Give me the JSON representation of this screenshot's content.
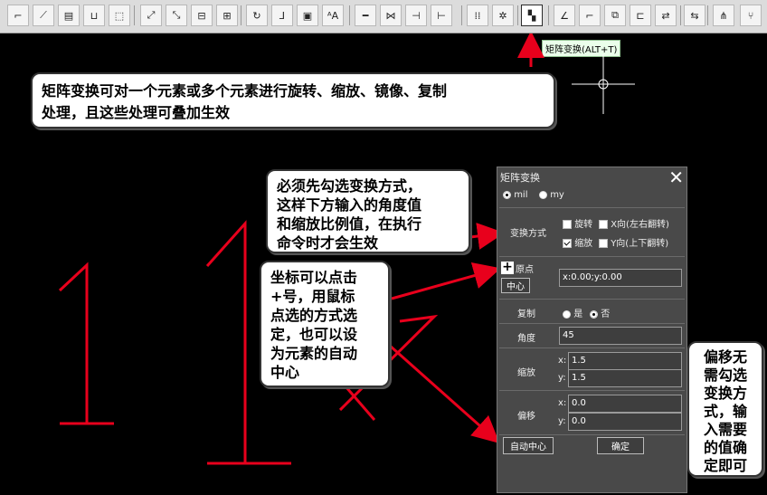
{
  "toolbar": {
    "buttons": [
      {
        "name": "connect-icon",
        "glyph": "⌐"
      },
      {
        "name": "route-icon",
        "glyph": "⟋"
      },
      {
        "name": "document-settings-icon",
        "glyph": "▤"
      },
      {
        "name": "tray-icon",
        "glyph": "⊔"
      },
      {
        "name": "select-box-icon",
        "glyph": "⬚"
      },
      {
        "name": "transform-icon",
        "glyph": "⤢"
      },
      {
        "name": "resize-icon",
        "glyph": "⤡"
      },
      {
        "name": "align-center-icon",
        "glyph": "⊟"
      },
      {
        "name": "align-middle-icon",
        "glyph": "⊞"
      },
      {
        "name": "rotate-icon",
        "glyph": "↻"
      },
      {
        "name": "flip-icon",
        "glyph": "⅃"
      },
      {
        "name": "layer-settings-icon",
        "glyph": "▣"
      },
      {
        "name": "text-size-icon",
        "glyph": "ᴬA"
      },
      {
        "name": "wire-break-icon",
        "glyph": "━"
      },
      {
        "name": "cross-wire-icon",
        "glyph": "⋈"
      },
      {
        "name": "line-left-icon",
        "glyph": "⊣"
      },
      {
        "name": "line-right-icon",
        "glyph": "⊢"
      },
      {
        "name": "grid-icon",
        "glyph": "⁞⁞"
      },
      {
        "name": "snowflake-icon",
        "glyph": "✲"
      },
      {
        "name": "matrix-transform-icon",
        "glyph": "▚"
      },
      {
        "name": "angle-icon",
        "glyph": "∠"
      },
      {
        "name": "step-icon",
        "glyph": "⌐"
      },
      {
        "name": "copy-icon",
        "glyph": "⧉"
      },
      {
        "name": "component-icon",
        "glyph": "⊏"
      },
      {
        "name": "swap-icon",
        "glyph": "⇄"
      },
      {
        "name": "group-swap-icon",
        "glyph": "⇆"
      },
      {
        "name": "tree-icon",
        "glyph": "⋔"
      },
      {
        "name": "branch-icon",
        "glyph": "⑂"
      }
    ],
    "tooltip": "矩阵变换(ALT+T)"
  },
  "callouts": {
    "c1": [
      "矩阵变换可对一个元素或多个元素进行旋转、缩放、镜像、复制",
      "处理，且这些处理可叠加生效"
    ],
    "c2": [
      "必须先勾选变换方式，",
      "这样下方输入的角度值",
      "和缩放比例值，在执行",
      "命令时才会生效"
    ],
    "c3": [
      "坐标可以点击",
      "+号，用鼠标",
      "点选的方式选",
      "定，也可以设",
      "为元素的自动",
      "中心"
    ],
    "c4": [
      "偏移无",
      "需勾选",
      "变换方",
      "式，输",
      "入需要",
      "的值确",
      "定即可"
    ]
  },
  "dialog": {
    "title": "矩阵变换",
    "close": "✕",
    "unit_mil": "mil",
    "unit_my": "my",
    "transform_mode_label": "变换方式",
    "rotate": "旋转",
    "scale": "缩放",
    "x_flip": "X向(左右翻转)",
    "y_flip": "Y向(上下翻转)",
    "rotate_checked": false,
    "scale_checked": true,
    "x_flip_checked": false,
    "y_flip_checked": false,
    "origin_label": "原点",
    "origin_value": "x:0.00;y:0.00",
    "center_button": "中心",
    "copy_label": "复制",
    "copy_yes": "是",
    "copy_no": "否",
    "angle_label": "角度",
    "angle_value": "45",
    "scale_label": "缩放",
    "scale_x_prefix": "x:",
    "scale_x_value": "1.5",
    "scale_y_prefix": "y:",
    "scale_y_value": "1.5",
    "offset_label": "偏移",
    "offset_x_prefix": "x:",
    "offset_x_value": "0.0",
    "offset_y_prefix": "y:",
    "offset_y_value": "0.0",
    "auto_center_button": "自动中心",
    "ok_button": "确定"
  },
  "colors": {
    "annotation": "#e8001c",
    "dialog_bg": "#494949",
    "toolbar_bg": "#dcdcdc"
  }
}
